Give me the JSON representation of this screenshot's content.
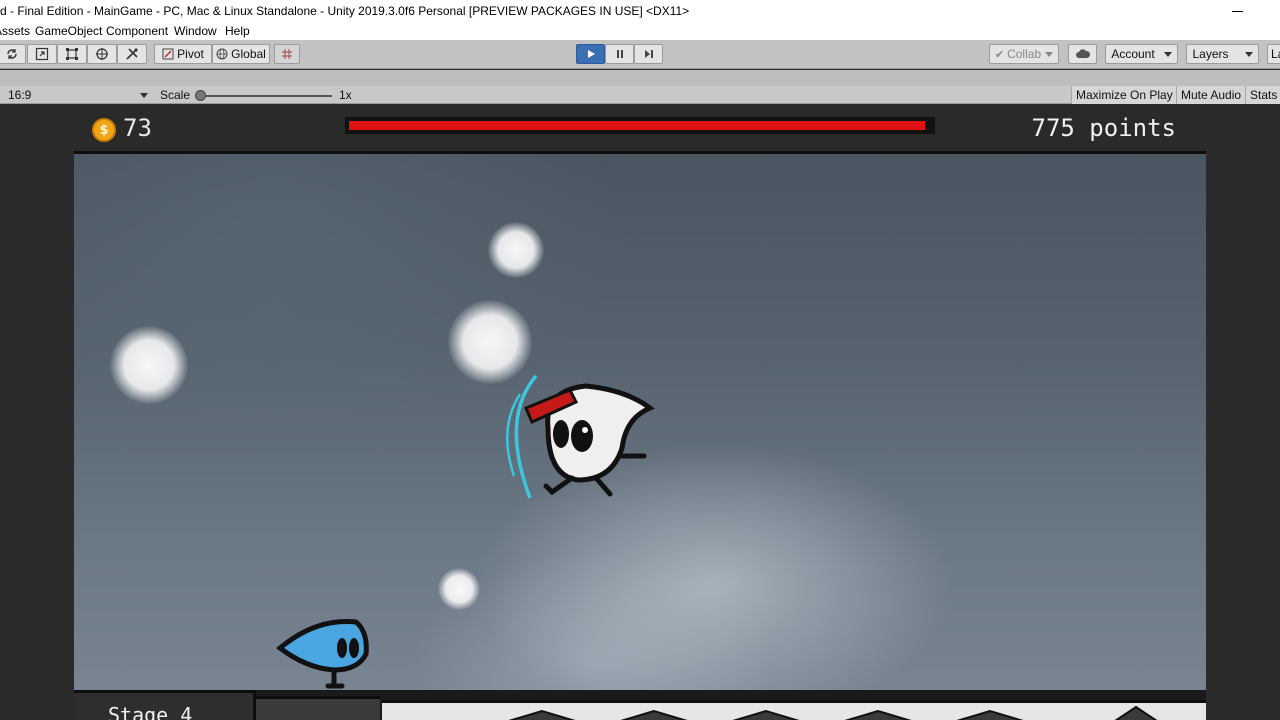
{
  "window": {
    "title": "d - Final Edition - MainGame - PC, Mac & Linux Standalone - Unity 2019.3.0f6 Personal [PREVIEW PACKAGES IN USE] <DX11>"
  },
  "menu": {
    "items": [
      "Assets",
      "GameObject",
      "Component",
      "Window",
      "Help"
    ]
  },
  "toolbar": {
    "pivot_label": "Pivot",
    "global_label": "Global",
    "collab_label": "Collab",
    "account_label": "Account",
    "layers_label": "Layers",
    "layout_label": "La"
  },
  "game_view": {
    "aspect": "16:9",
    "scale_label": "Scale",
    "scale_value": "1x",
    "maximize_label": "Maximize On Play",
    "mute_label": "Mute Audio",
    "stats_label": "Stats"
  },
  "hud": {
    "coins": "73",
    "coin_symbol": "$",
    "health_fraction": 0.99,
    "points": "775 points",
    "stage": "Stage 4"
  },
  "colors": {
    "health": "#e11212",
    "coin": "#f2a516",
    "play_active": "#3a6fb5",
    "ninja_band": "#c61a1a",
    "dash_arc": "#3cc6e0",
    "blue_enemy": "#4aa6e0"
  }
}
